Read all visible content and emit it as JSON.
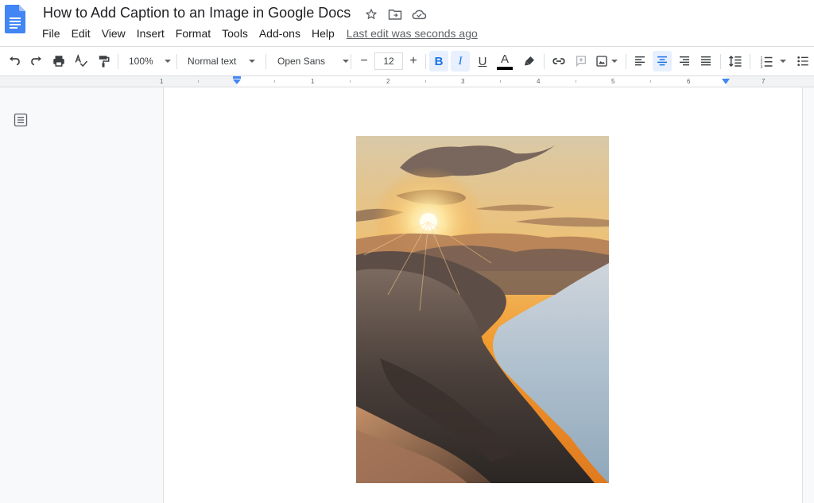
{
  "doc": {
    "title": "How to Add Caption to an Image in Google Docs"
  },
  "menu": {
    "items": [
      "File",
      "Edit",
      "View",
      "Insert",
      "Format",
      "Tools",
      "Add-ons",
      "Help"
    ],
    "last_edit": "Last edit was seconds ago"
  },
  "toolbar": {
    "zoom": "100%",
    "style": "Normal text",
    "font": "Open Sans",
    "font_size": "12",
    "minus": "−",
    "plus": "+",
    "bold": "B",
    "italic": "I",
    "underline": "U",
    "text_color_letter": "A"
  },
  "ruler": {
    "numbers": [
      "1",
      "1",
      "2",
      "3",
      "4",
      "5",
      "6",
      "7"
    ]
  },
  "colors": {
    "accent": "#1a73e8",
    "active_bg": "#e8f0fe",
    "doc_icon": "#4285f4"
  }
}
